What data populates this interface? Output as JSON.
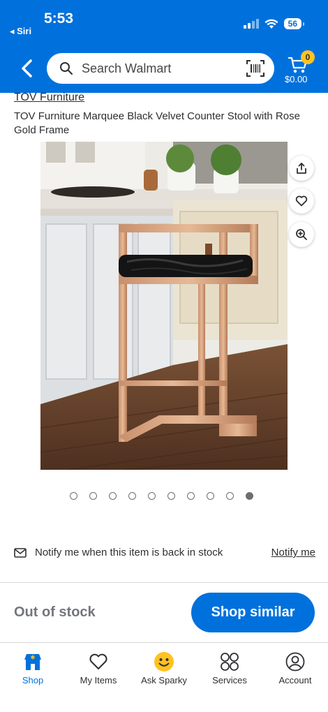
{
  "status_bar": {
    "time": "5:53",
    "back_app": "◂ Siri",
    "battery": "56"
  },
  "header": {
    "search_placeholder": "Search Walmart",
    "cart_count": "0",
    "cart_total": "$0.00"
  },
  "product": {
    "brand": "TOV Furniture",
    "title": "TOV Furniture Marquee Black Velvet Counter Stool with Rose Gold Frame",
    "image_count": 10,
    "active_image_index": 9
  },
  "actions": {
    "share_icon": "share-icon",
    "favorite_icon": "heart-icon",
    "zoom_icon": "zoom-in-icon"
  },
  "notify": {
    "text": "Notify me when this item is back in stock",
    "link": "Notify me"
  },
  "purchase": {
    "status": "Out of stock",
    "button": "Shop similar"
  },
  "nav": {
    "items": [
      {
        "label": "Shop",
        "icon": "store-icon",
        "active": true
      },
      {
        "label": "My Items",
        "icon": "heart-icon",
        "active": false
      },
      {
        "label": "Ask Sparky",
        "icon": "sparky-icon",
        "active": false
      },
      {
        "label": "Services",
        "icon": "services-icon",
        "active": false
      },
      {
        "label": "Account",
        "icon": "account-icon",
        "active": false
      }
    ]
  },
  "colors": {
    "brand_blue": "#0071dc",
    "badge_yellow": "#ffc220"
  }
}
